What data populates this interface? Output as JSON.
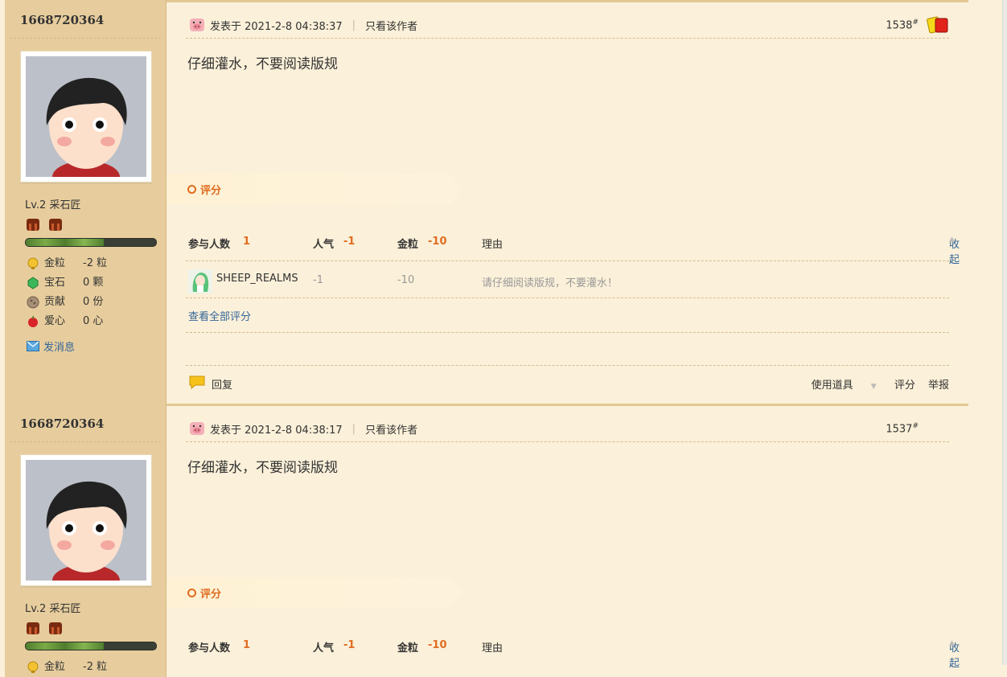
{
  "posts": [
    {
      "username": "1668720364",
      "level": "Lv.2 采石匠",
      "stats": [
        {
          "icon": "gold-coin-icon",
          "label": "金粒",
          "value": "-2 粒"
        },
        {
          "icon": "gem-icon",
          "label": "宝石",
          "value": "0 颗"
        },
        {
          "icon": "contribution-icon",
          "label": "贡献",
          "value": "0 份"
        },
        {
          "icon": "heart-apple-icon",
          "label": "爱心",
          "value": "0 心"
        }
      ],
      "send_message": "发消息",
      "posted_at": "发表于 2021-2-8 04:38:37",
      "only_author": "只看该作者",
      "floor": "1538",
      "floor_mark": "#",
      "content": "仔细灌水，不要阅读版规",
      "rating_label": "评分",
      "rating_header": {
        "participants_label": "参与人数",
        "participants": "1",
        "popularity_label": "人气",
        "popularity": "-1",
        "gold_label": "金粒",
        "gold": "-10",
        "reason_label": "理由",
        "collapse": "收起"
      },
      "ratings": [
        {
          "user": "SHEEP_REALMS",
          "popularity": "-1",
          "gold": "-10",
          "reason": "请仔细阅读版规，不要灌水！"
        }
      ],
      "view_all_ratings": "查看全部评分",
      "footer": {
        "reply": "回复",
        "use_item": "使用道具",
        "rate": "评分",
        "report": "举报"
      }
    },
    {
      "username": "1668720364",
      "level": "Lv.2 采石匠",
      "stats": [
        {
          "icon": "gold-coin-icon",
          "label": "金粒",
          "value": "-2 粒"
        }
      ],
      "posted_at": "发表于 2021-2-8 04:38:17",
      "only_author": "只看该作者",
      "floor": "1537",
      "floor_mark": "#",
      "content": "仔细灌水，不要阅读版规",
      "rating_label": "评分",
      "rating_header": {
        "participants_label": "参与人数",
        "participants": "1",
        "popularity_label": "人气",
        "popularity": "-1",
        "gold_label": "金粒",
        "gold": "-10",
        "reason_label": "理由",
        "collapse": "收起"
      }
    }
  ],
  "colors": {
    "accent_orange": "#e06c20",
    "link_blue": "#336699",
    "sidebar_bg": "#e7cd9d",
    "page_bg": "#fbf0d9"
  }
}
